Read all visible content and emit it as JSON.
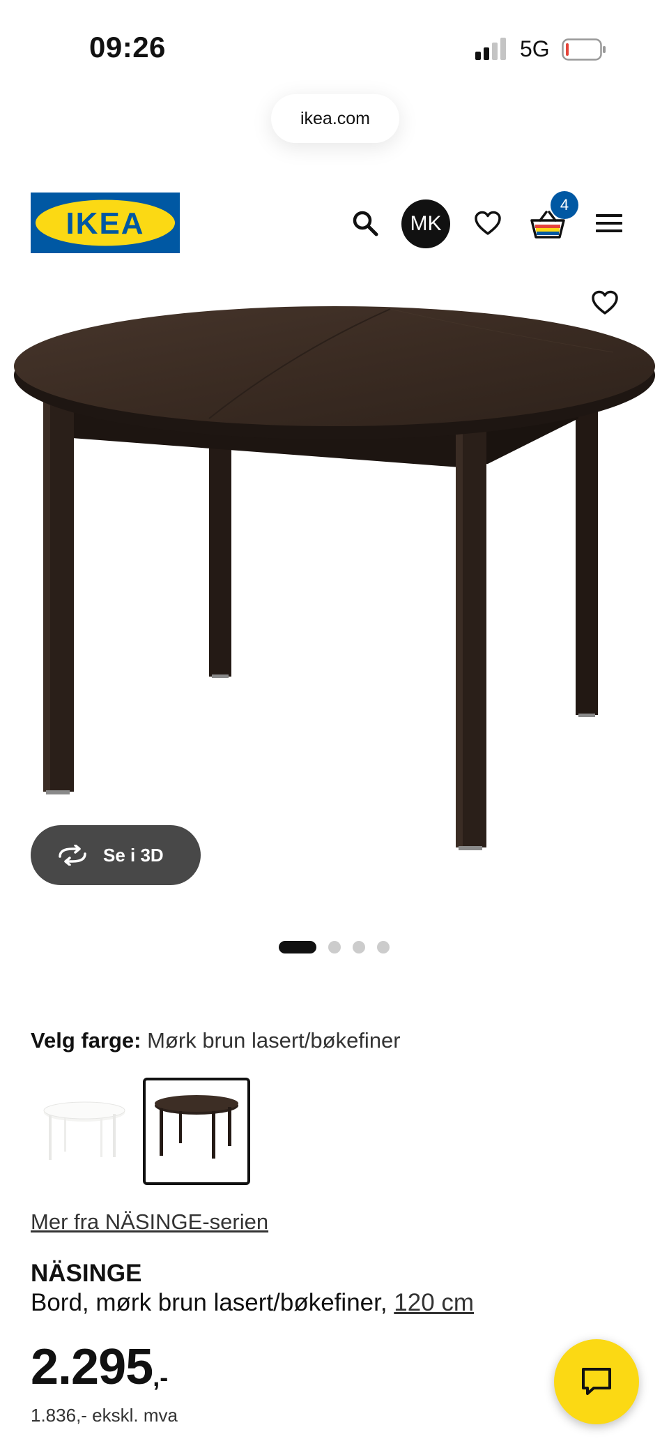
{
  "status_bar": {
    "time": "09:26",
    "network": "5G"
  },
  "browser": {
    "url": "ikea.com"
  },
  "header": {
    "logo_text": "IKEA",
    "avatar_initials": "MK",
    "cart_count": "4",
    "icons": [
      "search-icon",
      "heart-icon",
      "basket-icon",
      "menu-icon"
    ],
    "brand_colors": {
      "blue": "#0058a3",
      "yellow": "#fbd914"
    }
  },
  "gallery": {
    "view_3d_label": "Se i 3D",
    "dots_total": 4,
    "active_dot": 1
  },
  "color_select": {
    "label": "Velg farge:",
    "value": "Mørk brun lasert/bøkefiner",
    "options": [
      "white",
      "dark-brown"
    ],
    "selected_index": 1
  },
  "product": {
    "series_link": "Mer fra NÄSINGE-serien",
    "name": "NÄSINGE",
    "description": "Bord, mørk brun lasert/bøkefiner, ",
    "size_link": "120 cm",
    "price": "2.295",
    "price_suffix": ",-",
    "price_ex_vat": "1.836,- ekskl. mva"
  }
}
